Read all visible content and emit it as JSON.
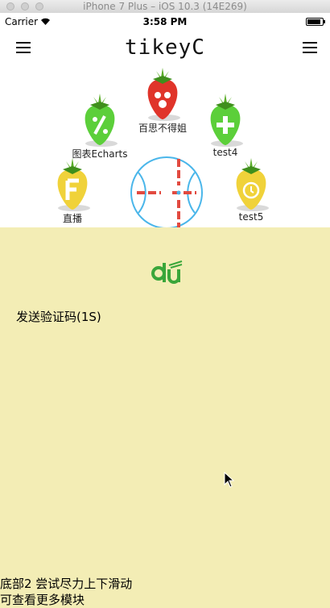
{
  "window": {
    "title": "iPhone 7 Plus – iOS 10.3 (14E269)"
  },
  "status_bar": {
    "carrier": "Carrier",
    "time": "3:58 PM",
    "battery_level": 0.9
  },
  "nav": {
    "brand": "tikeyC",
    "left_icon": "hamburger-icon",
    "right_icon": "hamburger-icon"
  },
  "menu": {
    "items": [
      {
        "label": "百思不得姐",
        "color": "#e0342a",
        "glyph": "dots"
      },
      {
        "label": "图表Echarts",
        "color": "#5ccf3a",
        "glyph": "percent"
      },
      {
        "label": "test4",
        "color": "#5ccf3a",
        "glyph": "plus"
      },
      {
        "label": "直播",
        "color": "#f0d23a",
        "glyph": "F"
      },
      {
        "label": "test5",
        "color": "#f0d23a",
        "glyph": "timer"
      }
    ],
    "center_button": {
      "icon": "crosshair-icon",
      "ring_color": "#4ab6ea",
      "cross_color": "#e24a40"
    }
  },
  "content": {
    "logo": "du",
    "verify_button": "发送验证码(1S)",
    "bottom_line1": "底部2 尝试尽力上下滑动",
    "bottom_line2": "可查看更多模块"
  }
}
